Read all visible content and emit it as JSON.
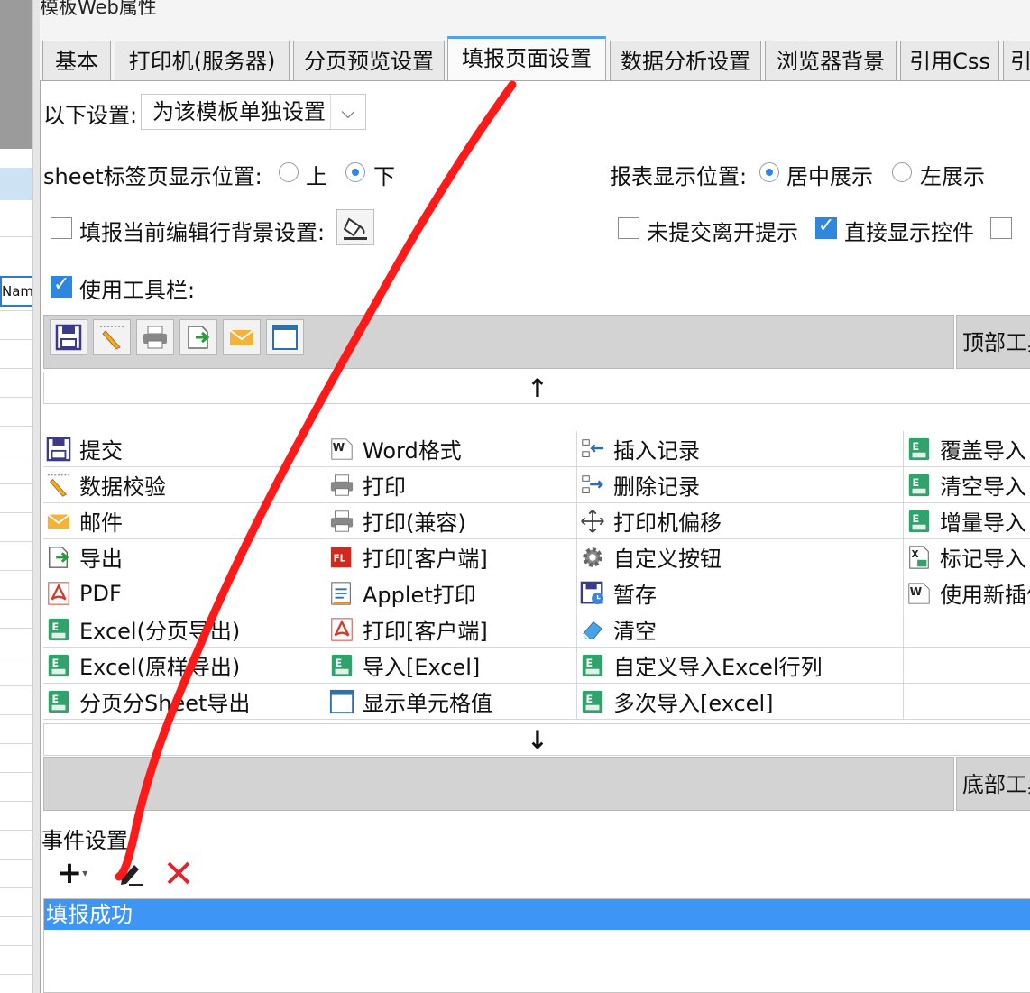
{
  "window": {
    "title": "模板Web属性"
  },
  "background_sheet": {
    "name_cell": "Nam"
  },
  "tabs": [
    {
      "label": "基本"
    },
    {
      "label": "打印机(服务器)"
    },
    {
      "label": "分页预览设置"
    },
    {
      "label": "填报页面设置",
      "active": true
    },
    {
      "label": "数据分析设置"
    },
    {
      "label": "浏览器背景"
    },
    {
      "label": "引用Css"
    },
    {
      "label": "引"
    }
  ],
  "settings": {
    "scope_label": "以下设置:",
    "scope_value": "为该模板单独设置",
    "sheet_tab_label": "sheet标签页显示位置:",
    "sheet_top": "上",
    "sheet_bottom": "下",
    "report_pos_label": "报表显示位置:",
    "report_center": "居中展示",
    "report_left": "左展示",
    "edit_row_bg_label": "填报当前编辑行背景设置:",
    "unsubmitted_prompt": "未提交离开提示",
    "show_controls": "直接显示控件",
    "use_toolbar": "使用工具栏:"
  },
  "toolbar_zones": {
    "top": "顶部工具栏",
    "bottom": "底部工具栏"
  },
  "button_grid": [
    [
      {
        "label": "提交",
        "icon": "save-icon"
      },
      {
        "label": "Word格式",
        "icon": "word-icon"
      },
      {
        "label": "插入记录",
        "icon": "insert-record-icon"
      },
      {
        "label": "覆盖导入",
        "icon": "excel-icon"
      }
    ],
    [
      {
        "label": "数据校验",
        "icon": "pencil-icon"
      },
      {
        "label": "打印",
        "icon": "printer-icon"
      },
      {
        "label": "删除记录",
        "icon": "delete-record-icon"
      },
      {
        "label": "清空导入",
        "icon": "excel-icon"
      }
    ],
    [
      {
        "label": "邮件",
        "icon": "mail-icon"
      },
      {
        "label": "打印(兼容)",
        "icon": "printer-icon"
      },
      {
        "label": "打印机偏移",
        "icon": "move-icon"
      },
      {
        "label": "增量导入",
        "icon": "excel-icon"
      }
    ],
    [
      {
        "label": "导出",
        "icon": "export-icon"
      },
      {
        "label": "打印[客户端]",
        "icon": "flash-print-icon"
      },
      {
        "label": "自定义按钮",
        "icon": "gear-icon"
      },
      {
        "label": "标记导入",
        "icon": "mark-import-icon"
      }
    ],
    [
      {
        "label": "PDF",
        "icon": "pdf-icon"
      },
      {
        "label": "Applet打印",
        "icon": "applet-icon"
      },
      {
        "label": "暂存",
        "icon": "temp-save-icon"
      },
      {
        "label": "使用新插件",
        "icon": "word-icon"
      }
    ],
    [
      {
        "label": "Excel(分页导出)",
        "icon": "excel-icon"
      },
      {
        "label": "打印[客户端]",
        "icon": "pdf-icon"
      },
      {
        "label": "清空",
        "icon": "eraser-icon"
      },
      {
        "label": "",
        "icon": ""
      }
    ],
    [
      {
        "label": "Excel(原样导出)",
        "icon": "excel-icon"
      },
      {
        "label": "导入[Excel]",
        "icon": "excel-icon"
      },
      {
        "label": "自定义导入Excel行列",
        "icon": "excel-icon"
      },
      {
        "label": "",
        "icon": ""
      }
    ],
    [
      {
        "label": "分页分Sheet导出",
        "icon": "excel-icon"
      },
      {
        "label": "显示单元格值",
        "icon": "cell-icon"
      },
      {
        "label": "多次导入[excel]",
        "icon": "excel-icon"
      },
      {
        "label": "",
        "icon": ""
      }
    ]
  ],
  "events": {
    "label": "事件设置:",
    "items": [
      "填报成功"
    ]
  },
  "colors": {
    "accent": "#3d96f5",
    "annotation": "#ff1a1a"
  }
}
